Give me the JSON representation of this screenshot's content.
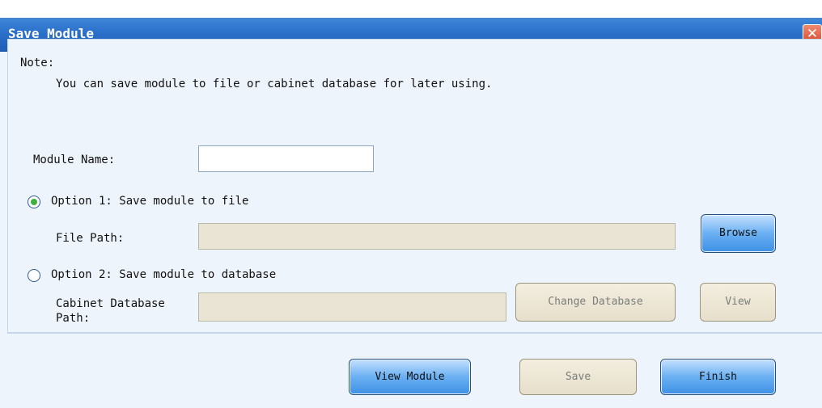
{
  "window": {
    "title": "Save Module"
  },
  "note": {
    "label": "Note:",
    "text": "You can save module to file or cabinet database for later using."
  },
  "module_name": {
    "label": "Module Name:",
    "value": ""
  },
  "option1": {
    "label": "Option 1: Save module to file",
    "selected": true
  },
  "file_path": {
    "label": "File Path:",
    "value": "",
    "browse_label": "Browse"
  },
  "option2": {
    "label": "Option 2: Save module to database",
    "selected": false
  },
  "cabinet_db": {
    "label_line1": "Cabinet Database",
    "label_line2": "Path:",
    "value": "",
    "change_label": "Change Database",
    "view_label": "View"
  },
  "footer": {
    "view_module_label": "View Module",
    "save_label": "Save",
    "finish_label": "Finish"
  },
  "icons": {
    "close": "close-icon",
    "radio_selected_color": "#3db03d"
  }
}
